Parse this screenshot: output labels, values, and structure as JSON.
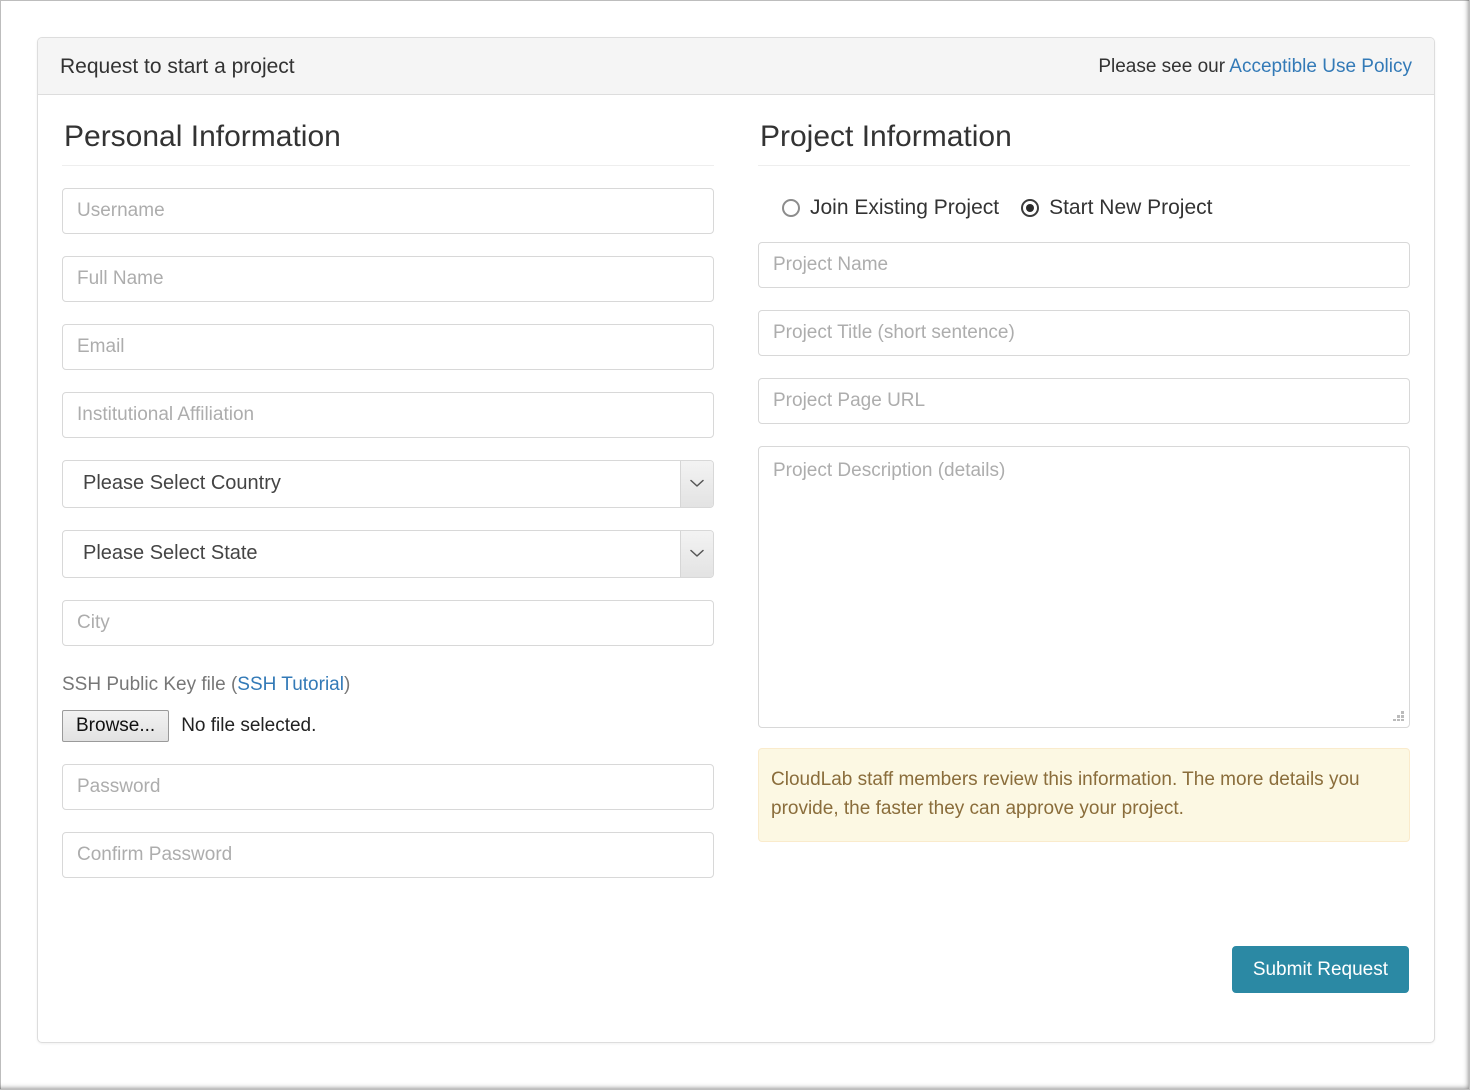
{
  "panel": {
    "title": "Request to start a project",
    "policy_prefix": "Please see our ",
    "policy_link": "Acceptible Use Policy",
    "policy_link_color": "#337ab7"
  },
  "personal": {
    "heading": "Personal Information",
    "fields": [
      {
        "name": "username",
        "placeholder": "Username",
        "value": ""
      },
      {
        "name": "full-name",
        "placeholder": "Full Name",
        "value": ""
      },
      {
        "name": "email",
        "placeholder": "Email",
        "value": ""
      },
      {
        "name": "institutional-affiliation",
        "placeholder": "Institutional Affiliation",
        "value": ""
      }
    ],
    "country_select": {
      "selected": "Please Select Country",
      "icon": "chevron-down-icon"
    },
    "state_select": {
      "selected": "Please Select State",
      "icon": "chevron-down-icon"
    },
    "city_field": {
      "placeholder": "City",
      "value": ""
    },
    "ssh": {
      "label_prefix": "SSH Public Key file (",
      "link": "SSH Tutorial",
      "label_suffix": ")",
      "browse_label": "Browse...",
      "file_status": "No file selected."
    },
    "password_field": {
      "placeholder": "Password",
      "value": ""
    },
    "confirm_password_field": {
      "placeholder": "Confirm Password",
      "value": ""
    }
  },
  "project": {
    "heading": "Project Information",
    "radios": [
      {
        "label": "Join Existing Project",
        "checked": false
      },
      {
        "label": "Start New Project",
        "checked": true
      }
    ],
    "name_field": {
      "placeholder": "Project Name",
      "value": ""
    },
    "title_field": {
      "placeholder": "Project Title (short sentence)",
      "value": ""
    },
    "url_field": {
      "placeholder": "Project Page URL",
      "value": ""
    },
    "description_field": {
      "placeholder": "Project Description (details)",
      "value": ""
    },
    "notice": "CloudLab staff members review this information. The more details you provide, the faster they can approve your project.",
    "notice_bg": "#fcf8e3",
    "notice_border": "#faebcc",
    "notice_text_color": "#8a6d3b",
    "submit_label": "Submit Request",
    "submit_color": "#2b89a4"
  }
}
